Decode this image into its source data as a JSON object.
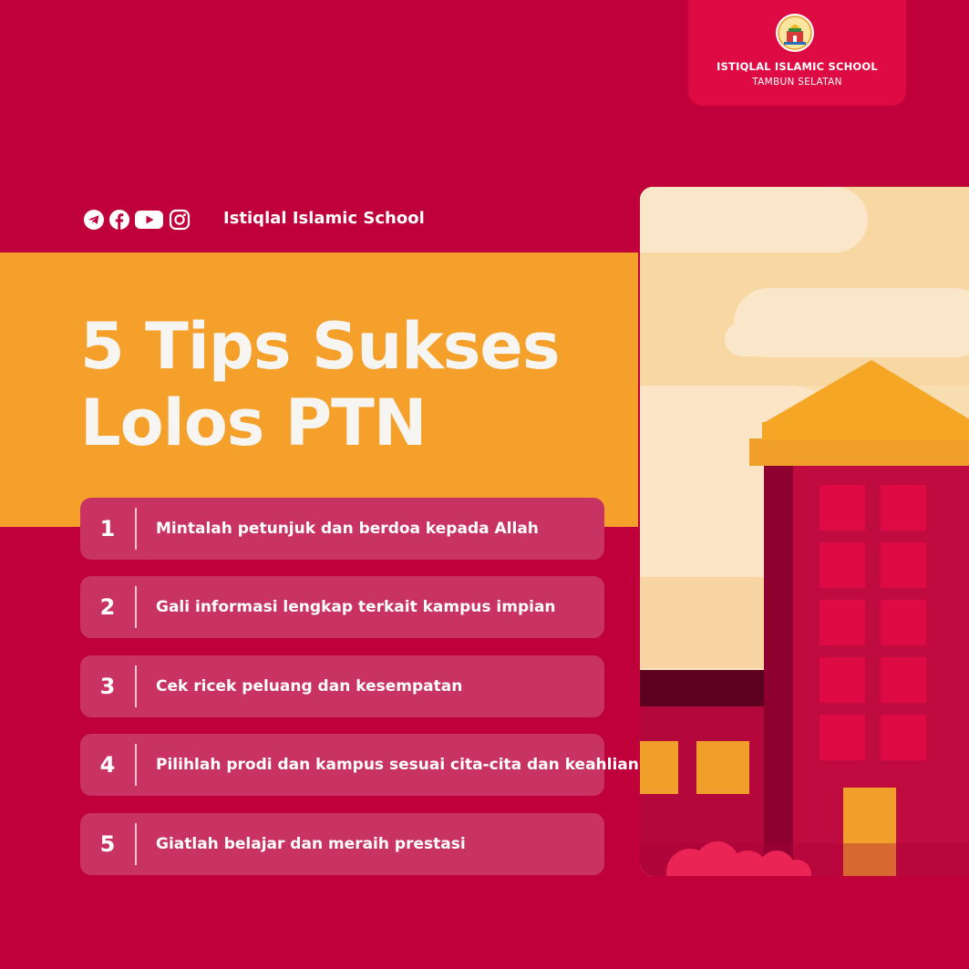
{
  "brand": {
    "title": "ISTIQLAL ISLAMIC SCHOOL",
    "subtitle": "TAMBUN SELATAN",
    "logo_icon": "school-logo-icon"
  },
  "social": {
    "icons": [
      "telegram-icon",
      "facebook-icon",
      "youtube-icon",
      "instagram-icon"
    ],
    "handle": "Istiqlal Islamic School"
  },
  "headline": {
    "line1": "5 Tips Sukses",
    "line2": "Lolos PTN"
  },
  "tips": [
    {
      "number": "1",
      "text": "Mintalah petunjuk dan berdoa kepada Allah"
    },
    {
      "number": "2",
      "text": "Gali informasi lengkap terkait kampus impian"
    },
    {
      "number": "3",
      "text": "Cek ricek peluang dan kesempatan"
    },
    {
      "number": "4",
      "text": "Pilihlah prodi dan kampus sesuai cita-cita dan keahlian"
    },
    {
      "number": "5",
      "text": "Giatlah belajar dan meraih prestasi"
    }
  ],
  "colors": {
    "background": "#bf003a",
    "band": "#f5a02a",
    "card": "#c83363",
    "badge": "#de0a43"
  }
}
